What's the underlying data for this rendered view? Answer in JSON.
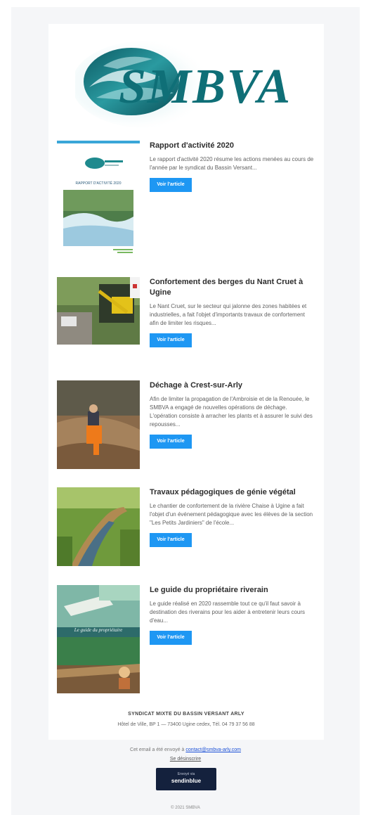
{
  "header": {
    "logo_text": "SMBVA"
  },
  "articles": [
    {
      "title": "Rapport d'activité 2020",
      "text": "Le rapport d'activité 2020 résume les actions menées au cours de l'année par le syndicat du Bassin Versant...",
      "button": "Voir l'article",
      "thumb_caption": "RAPPORT D'ACTIVITÉ 2020"
    },
    {
      "title": "Confortement des berges du Nant Cruet à Ugine",
      "text": "Le Nant Cruet, sur le secteur qui jalonne des zones habitées et industrielles, a fait l'objet d'importants travaux de confortement afin de limiter les risques...",
      "button": "Voir l'article"
    },
    {
      "title": "Déchage à Crest-sur-Arly",
      "text": "Afin de limiter la propagation de l'Ambroisie et de la Renouée, le SMBVA a engagé de nouvelles opérations de déchage. L'opération consiste à arracher les plants et à assurer le suivi des repousses...",
      "button": "Voir l'article"
    },
    {
      "title": "Travaux pédagogiques de génie végétal",
      "text": "Le chantier de confortement de la rivière Chaise à Ugine a fait l'objet d'un événement pédagogique avec les élèves de la section \"Les Petits Jardiniers\" de l'école...",
      "button": "Voir l'article"
    },
    {
      "title": "Le guide du propriétaire riverain",
      "text": "Le guide réalisé en 2020 rassemble tout ce qu'il faut savoir à destination des riverains pour les aider à entretenir leurs cours d'eau...",
      "button": "Voir l'article",
      "thumb_caption": "Le guide du propriétaire"
    }
  ],
  "footer": {
    "org": "SYNDICAT MIXTE DU BASSIN VERSANT ARLY",
    "address": "Hôtel de Ville, BP 1 — 73400 Ugine cedex, Tél. 04 79 37 56 88"
  },
  "notice": {
    "text": "Cet email a été envoyé à",
    "email": "contact@smbva-arly.com",
    "unsubscribe": "Se désinscrire"
  },
  "badge": {
    "line1": "Envoyé via",
    "line2": "sendinblue"
  },
  "copyright": "© 2021 SMBVA",
  "colors": {
    "button": "#1e97f3",
    "logo_teal": "#0f6f77",
    "page_bg": "#f5f6f8"
  }
}
